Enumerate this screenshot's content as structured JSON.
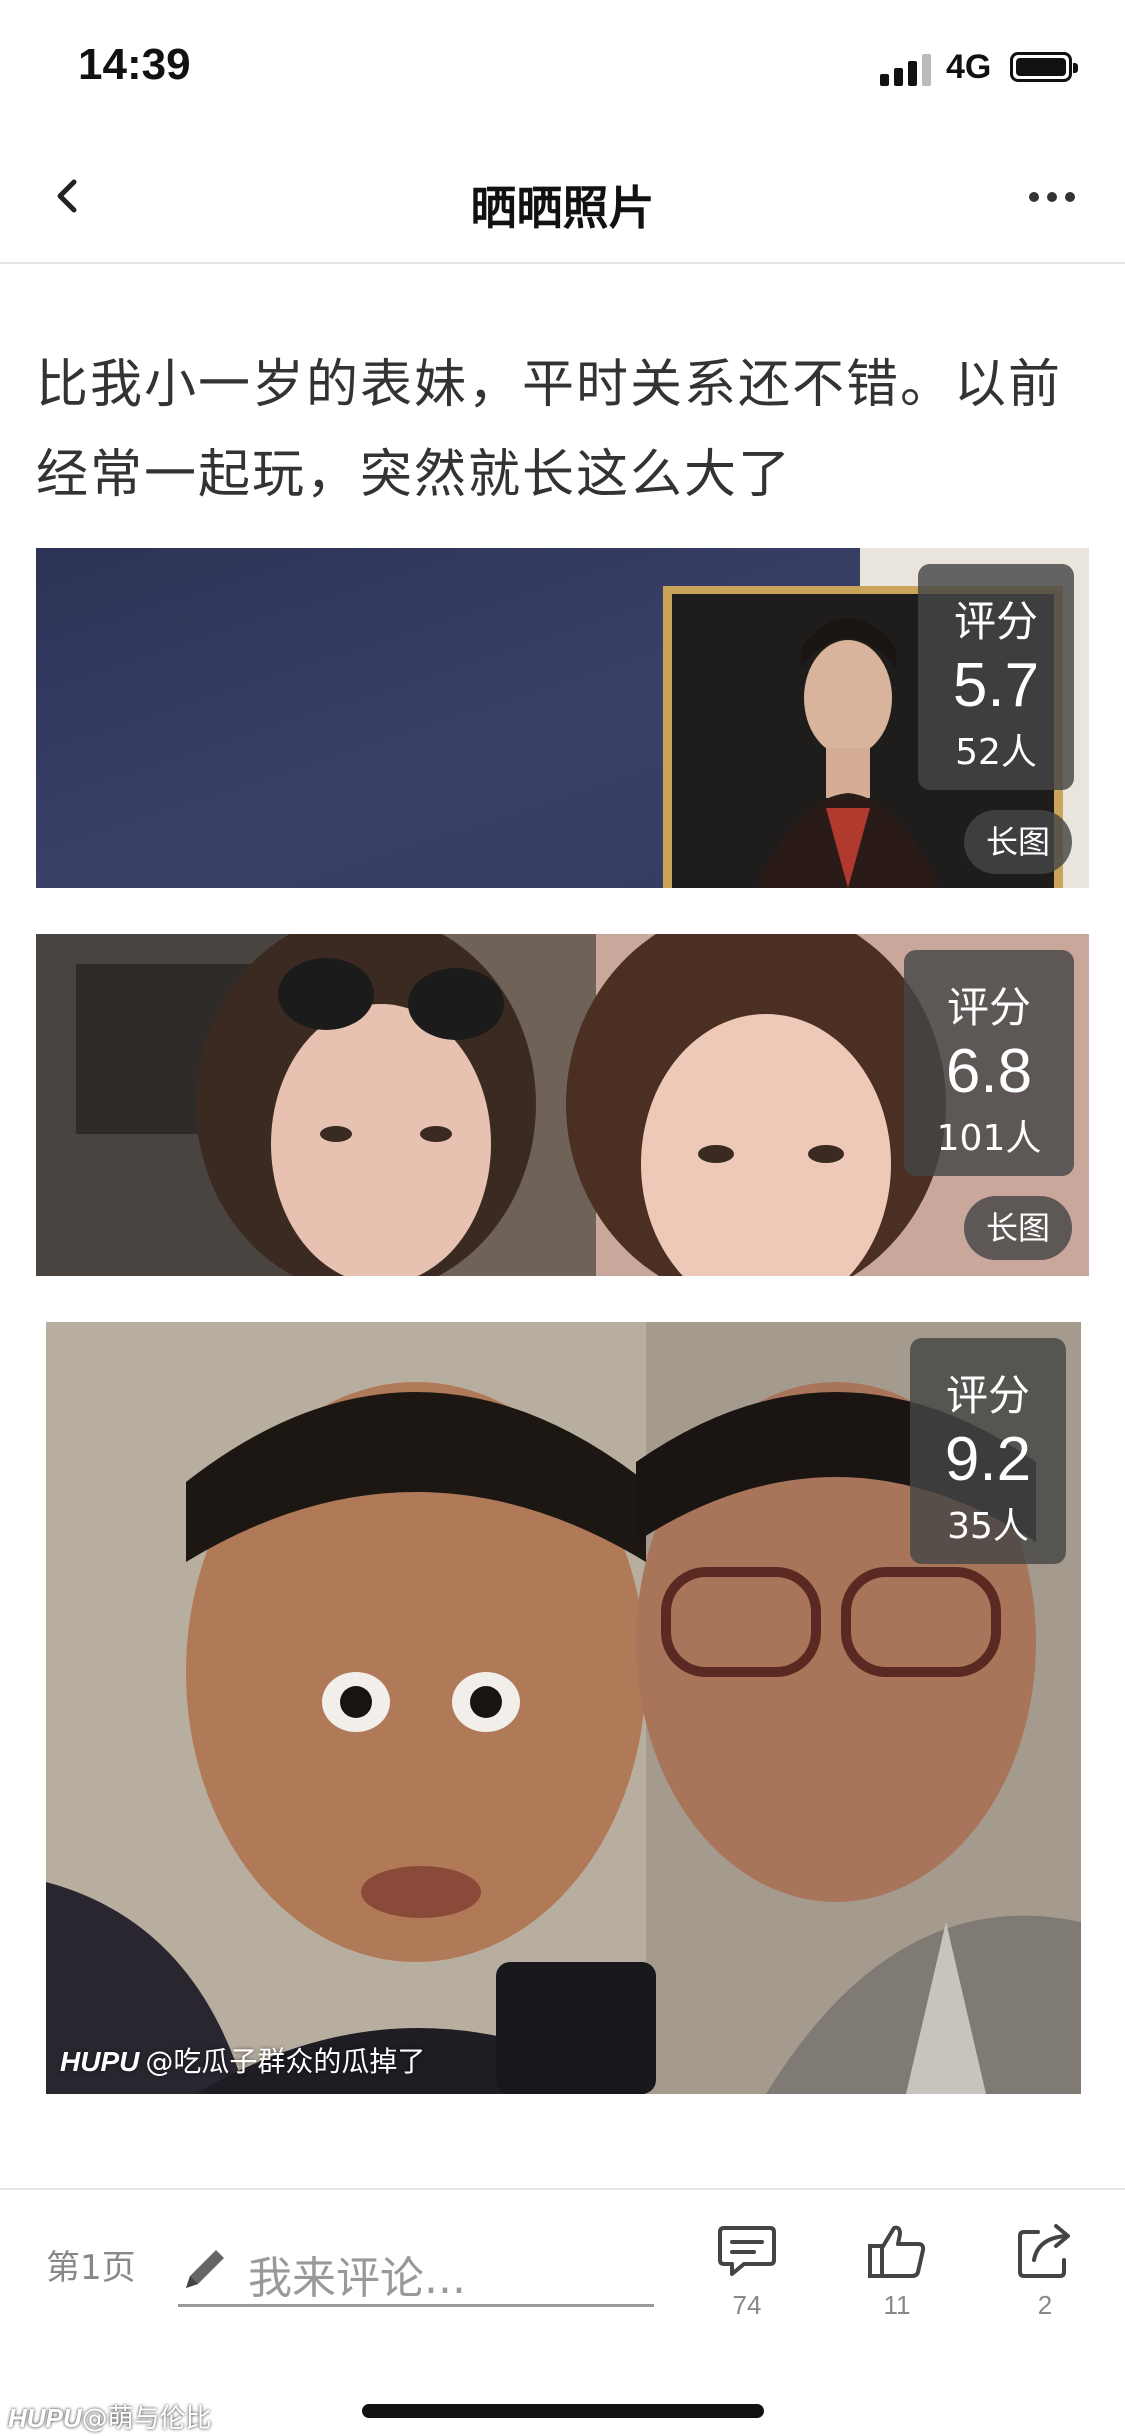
{
  "status": {
    "time": "14:39",
    "network": "4G"
  },
  "nav": {
    "title": "晒晒照片"
  },
  "post": {
    "text": "比我小一岁的表妹，平时关系还不错。以前经常一起玩，突然就长这么大了"
  },
  "photos": [
    {
      "rating_label": "评分",
      "score": "5.7",
      "count": "52人",
      "tag": "长图"
    },
    {
      "rating_label": "评分",
      "score": "6.8",
      "count": "101人",
      "tag": "长图"
    },
    {
      "rating_label": "评分",
      "score": "9.2",
      "count": "35人",
      "watermark_brand": "HUPU",
      "watermark_text": "@吃瓜子群众的瓜掉了"
    }
  ],
  "bottom": {
    "page": "第1页",
    "comment_placeholder": "我来评论...",
    "comments_count": "74",
    "likes_count": "11",
    "shares_count": "2",
    "footer_brand": "HUPU",
    "footer_user": "@萌与伦比"
  },
  "colors": {
    "overlay": "#464646",
    "divider": "#e4e4e4",
    "placeholder": "#999999"
  }
}
